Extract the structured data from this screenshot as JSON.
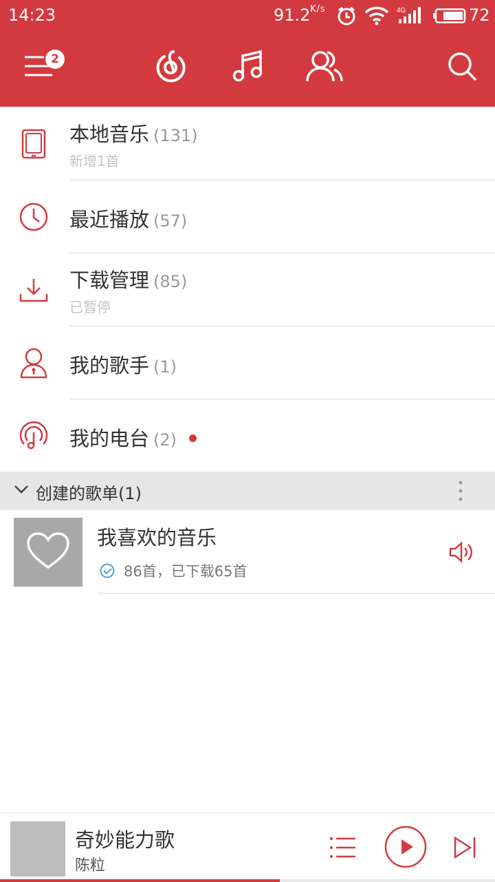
{
  "status_bar": {
    "time": "14:23",
    "speed": "91.2",
    "speed_unit": "K/s",
    "network": "4G",
    "battery": "72"
  },
  "nav": {
    "menu_badge": "2",
    "icons": [
      "menu-icon",
      "netease-music-icon",
      "music-note-icon",
      "friends-icon",
      "search-icon"
    ]
  },
  "menu": {
    "items": [
      {
        "label": "本地音乐",
        "count": "(131)",
        "sub": "新增1首",
        "icon": "phone-icon"
      },
      {
        "label": "最近播放",
        "count": "(57)",
        "sub": "",
        "icon": "clock-icon"
      },
      {
        "label": "下载管理",
        "count": "(85)",
        "sub": "已暂停",
        "icon": "download-icon"
      },
      {
        "label": "我的歌手",
        "count": "(1)",
        "sub": "",
        "icon": "singer-icon"
      },
      {
        "label": "我的电台",
        "count": "(2)",
        "sub": "",
        "icon": "radio-icon",
        "has_dot": true
      }
    ]
  },
  "section": {
    "label": "创建的歌单",
    "count": "(1)"
  },
  "playlist": {
    "title": "我喜欢的音乐",
    "meta": "86首，已下载65首"
  },
  "player": {
    "song": "奇妙能力歌",
    "artist": "陈粒",
    "progress": 0.565
  },
  "colors": {
    "accent": "#d33a3f",
    "section_bg": "#e6e6e6",
    "muted": "#999999"
  }
}
